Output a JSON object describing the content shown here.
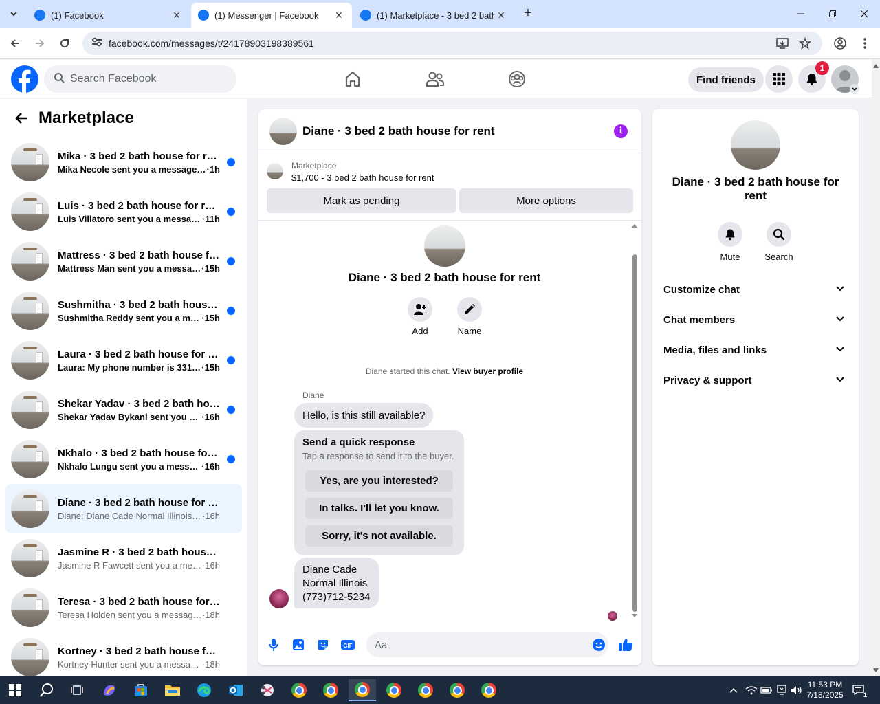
{
  "browser": {
    "tabs": [
      {
        "title": "(1) Facebook",
        "active": false
      },
      {
        "title": "(1) Messenger | Facebook",
        "active": true
      },
      {
        "title": "(1) Marketplace - 3 bed 2 bath",
        "active": false
      }
    ],
    "url": "facebook.com/messages/t/24178903198389561"
  },
  "fb": {
    "search_placeholder": "Search Facebook",
    "find_friends": "Find friends",
    "notification_count": "1"
  },
  "sidebar": {
    "title": "Marketplace",
    "conversations": [
      {
        "name": "Mika · 3 bed 2 bath house for rent",
        "snippet": "Mika Necole sent you a message a...",
        "time": "·1h",
        "unread": true
      },
      {
        "name": "Luis · 3 bed 2 bath house for rent",
        "snippet": "Luis Villatoro sent you a message...",
        "time": "·11h",
        "unread": true
      },
      {
        "name": "Mattress · 3 bed 2 bath house fo...",
        "snippet": "Mattress Man sent you a messag...",
        "time": "·15h",
        "unread": true
      },
      {
        "name": "Sushmitha · 3 bed 2 bath house f...",
        "snippet": "Sushmitha Reddy sent you a mes...",
        "time": "·15h",
        "unread": true
      },
      {
        "name": "Laura · 3 bed 2 bath house for rent",
        "snippet": "Laura: My phone number is 3312...",
        "time": "·15h",
        "unread": true
      },
      {
        "name": "Shekar Yadav · 3 bed 2 bath hou...",
        "snippet": "Shekar Yadav Bykani sent you a ...",
        "time": "·16h",
        "unread": true
      },
      {
        "name": "Nkhalo · 3 bed 2 bath house for ...",
        "snippet": "Nkhalo Lungu sent you a messag...",
        "time": "·16h",
        "unread": true
      },
      {
        "name": "Diane · 3 bed 2 bath house for rent",
        "snippet": "Diane: Diane Cade Normal Illinois (7...",
        "time": "·16h",
        "unread": false
      },
      {
        "name": "Jasmine R · 3 bed 2 bath house for...",
        "snippet": "Jasmine R Fawcett sent you a messa...",
        "time": "·16h",
        "unread": false
      },
      {
        "name": "Teresa · 3 bed 2 bath house for rent",
        "snippet": "Teresa Holden sent you a message a...",
        "time": "·18h",
        "unread": false
      },
      {
        "name": "Kortney · 3 bed 2 bath house for r...",
        "snippet": "Kortney Hunter sent you a message ...",
        "time": "·18h",
        "unread": false
      }
    ]
  },
  "chat": {
    "title": "Diane · 3 bed 2 bath house for rent",
    "listing_label": "Marketplace",
    "listing_detail": "$1,700 - 3 bed 2 bath house for rent",
    "mark_pending": "Mark as pending",
    "more_options": "More options",
    "intro_name": "Diane · 3 bed 2 bath house for rent",
    "add_label": "Add",
    "name_label": "Name",
    "started_text": "Diane started this chat.",
    "view_profile": "View buyer profile",
    "sender": "Diane",
    "msg1": "Hello, is this still available?",
    "quick_title": "Send a quick response",
    "quick_sub": "Tap a response to send it to the buyer.",
    "quick_replies": [
      "Yes, are you interested?",
      "In talks. I'll let you know.",
      "Sorry, it's not available."
    ],
    "msg2_lines": [
      "Diane Cade",
      "Normal Illinois",
      "(773)712-5234"
    ],
    "composer_placeholder": "Aa"
  },
  "info_panel": {
    "name": "Diane · 3 bed 2 bath house for rent",
    "mute": "Mute",
    "search": "Search",
    "sections": [
      "Customize chat",
      "Chat members",
      "Media, files and links",
      "Privacy & support"
    ]
  },
  "taskbar": {
    "time": "11:53 PM",
    "date": "7/18/2025",
    "notification_count": "1"
  },
  "colors": {
    "fb_blue": "#0866ff",
    "unread_dot": "#0866ff",
    "info_purple": "#a020f0",
    "badge_red": "#e41e3f"
  }
}
